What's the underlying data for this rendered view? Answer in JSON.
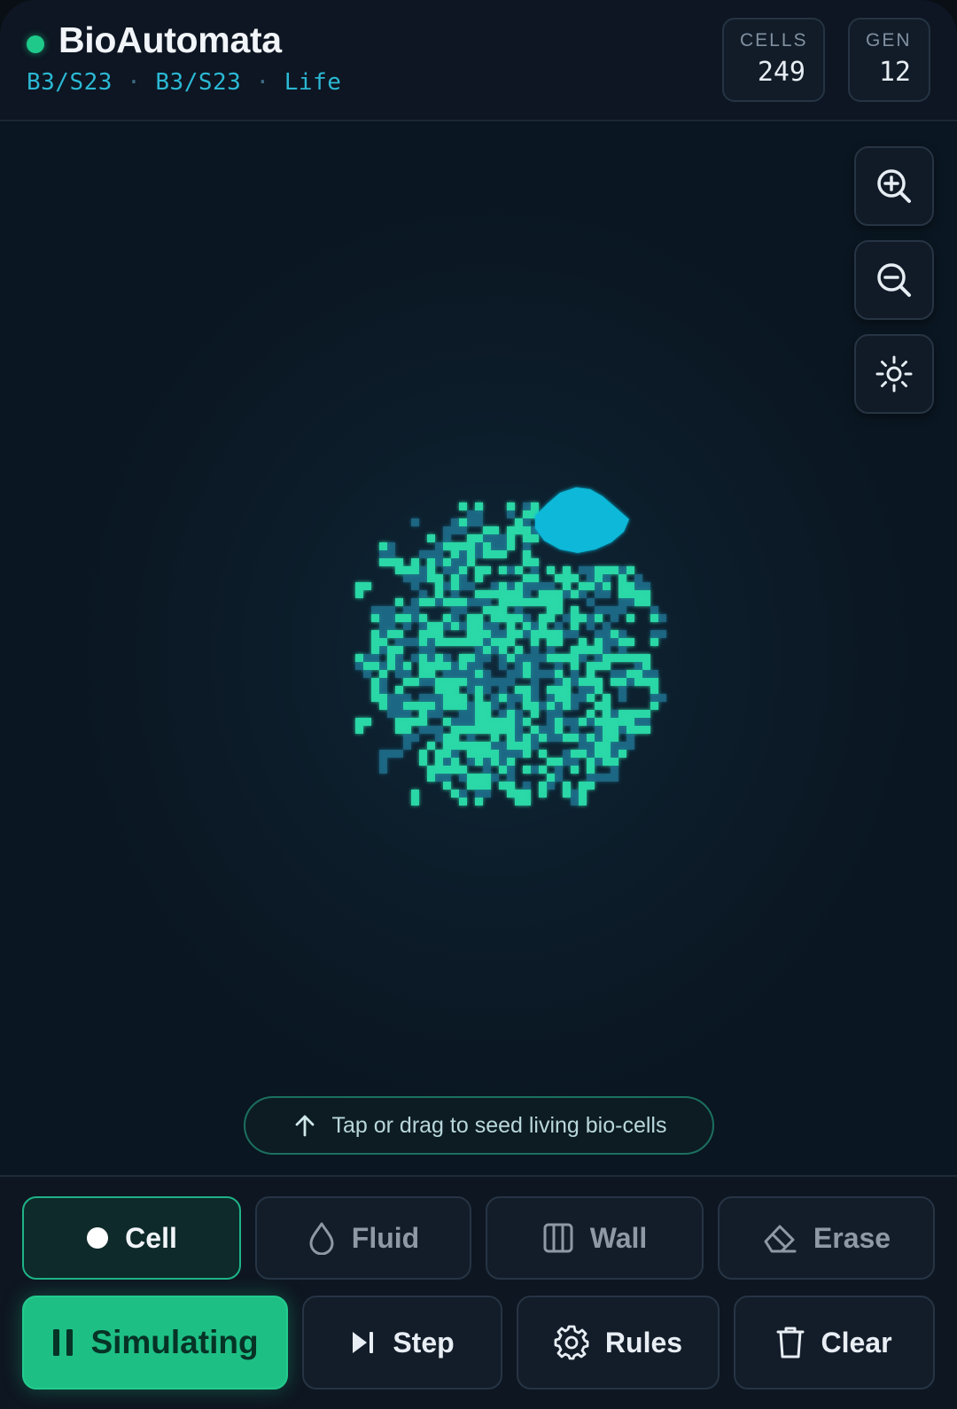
{
  "header": {
    "title": "BioAutomata",
    "rule_parts": [
      "B3/S23",
      "B3/S23",
      "Life"
    ],
    "stats": {
      "cells_label": "CELLS",
      "cells_value": "249",
      "gen_label": "GEN",
      "gen_value": "12"
    }
  },
  "canvas": {
    "hint": "Tap or drag to seed living bio-cells",
    "controls": [
      "zoom-in-icon",
      "zoom-out-icon",
      "brightness-icon"
    ]
  },
  "tools": {
    "selected": "Cell",
    "items": [
      {
        "label": "Cell",
        "icon": "dot-icon"
      },
      {
        "label": "Fluid",
        "icon": "droplet-icon"
      },
      {
        "label": "Wall",
        "icon": "columns-icon"
      },
      {
        "label": "Erase",
        "icon": "eraser-icon"
      }
    ]
  },
  "actions": {
    "simulate_label": "Simulating",
    "step_label": "Step",
    "rules_label": "Rules",
    "clear_label": "Clear"
  },
  "colors": {
    "accent": "#1ec98a",
    "live_cell": "#2bd9a8",
    "dying_cell": "#1d6b88",
    "fluid": "#0fb8d8",
    "rule_text": "#2bb8d4"
  }
}
